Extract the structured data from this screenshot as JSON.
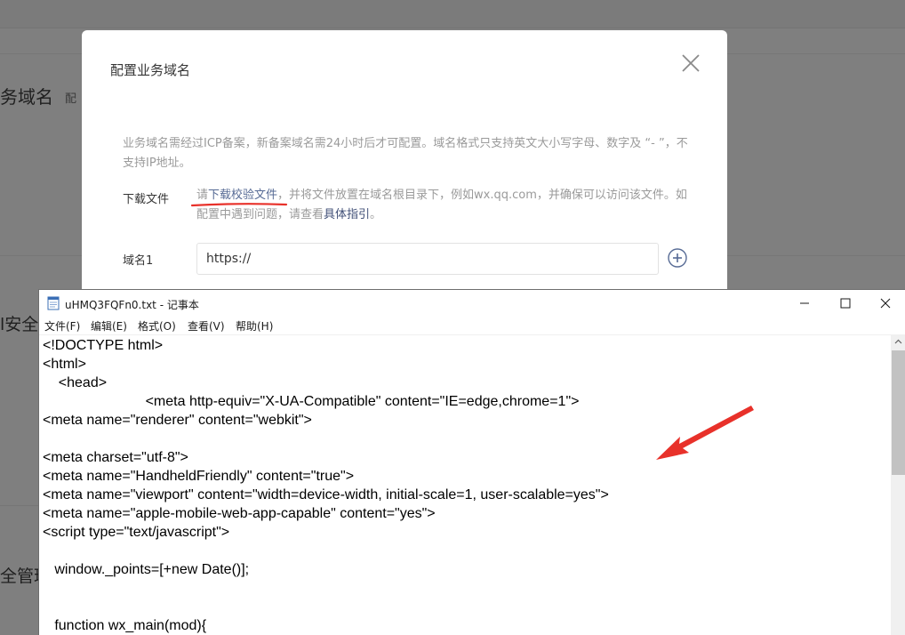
{
  "background": {
    "page_title": "务域名",
    "page_subtitle": "配",
    "side_text_1": "l安全",
    "side_text_2": "全管理"
  },
  "modal": {
    "title": "配置业务域名",
    "description": "业务域名需经过ICP备案，新备案域名需24小时后才可配置。域名格式只支持英文大小写字母、数字及 “- ”，不支持IP地址。",
    "download_label": "下载文件",
    "download_prefix": "请",
    "download_link": "下载校验文件",
    "download_middle": "，并将文件放置在域名根目录下，例如wx.qq.com，并确保可以访问该文件。如配置中遇到问题，请查看",
    "guide_link": "具体指引",
    "download_suffix": "。",
    "domain_label": "域名1",
    "domain_value": "https://",
    "close_icon": "close-icon",
    "add_icon": "plus-circle-icon"
  },
  "notepad": {
    "window_title": "uHMQ3FQFn0.txt - 记事本",
    "menu": [
      "文件(F)",
      "编辑(E)",
      "格式(O)",
      "查看(V)",
      "帮助(H)"
    ],
    "code": "<!DOCTYPE html>\n<html>\n    <head>\n                          <meta http-equiv=\"X-UA-Compatible\" content=\"IE=edge,chrome=1\">\n<meta name=\"renderer\" content=\"webkit\">\n\n<meta charset=\"utf-8\">\n<meta name=\"HandheldFriendly\" content=\"true\">\n<meta name=\"viewport\" content=\"width=device-width, initial-scale=1, user-scalable=yes\">\n<meta name=\"apple-mobile-web-app-capable\" content=\"yes\">\n<script type=\"text/javascript\">\n\n   window._points=[+new Date()];\n\n\n   function wx_main(mod){"
  },
  "colors": {
    "link": "#576b95",
    "annotation_red": "#e8312a",
    "muted_text": "#9a9a9a"
  }
}
